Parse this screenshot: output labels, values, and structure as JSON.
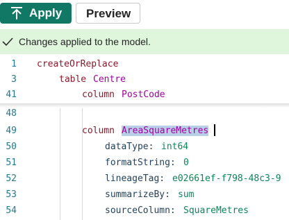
{
  "toolbar": {
    "apply_label": "Apply",
    "preview_label": "Preview"
  },
  "status": {
    "message": "Changes applied to the model."
  },
  "editor": {
    "sticky": [
      {
        "ln": "1",
        "kw": "createOrReplace",
        "rest": ""
      },
      {
        "ln": "3",
        "kw": "table",
        "rest": "Centre"
      },
      {
        "ln": "41",
        "kw": "column",
        "rest": "PostCode"
      }
    ],
    "lines": [
      {
        "ln": "48",
        "k": "",
        "v": ""
      },
      {
        "ln": "49",
        "k": "column",
        "v": "AreaSquareMetres"
      },
      {
        "ln": "50",
        "k": "dataType:",
        "v": "int64"
      },
      {
        "ln": "51",
        "k": "formatString:",
        "v": "0"
      },
      {
        "ln": "52",
        "k": "lineageTag:",
        "v": "e02661ef-f798-48c3-9"
      },
      {
        "ln": "53",
        "k": "summarizeBy:",
        "v": "sum"
      },
      {
        "ln": "54",
        "k": "sourceColumn:",
        "v": "SquareMetres"
      }
    ]
  }
}
